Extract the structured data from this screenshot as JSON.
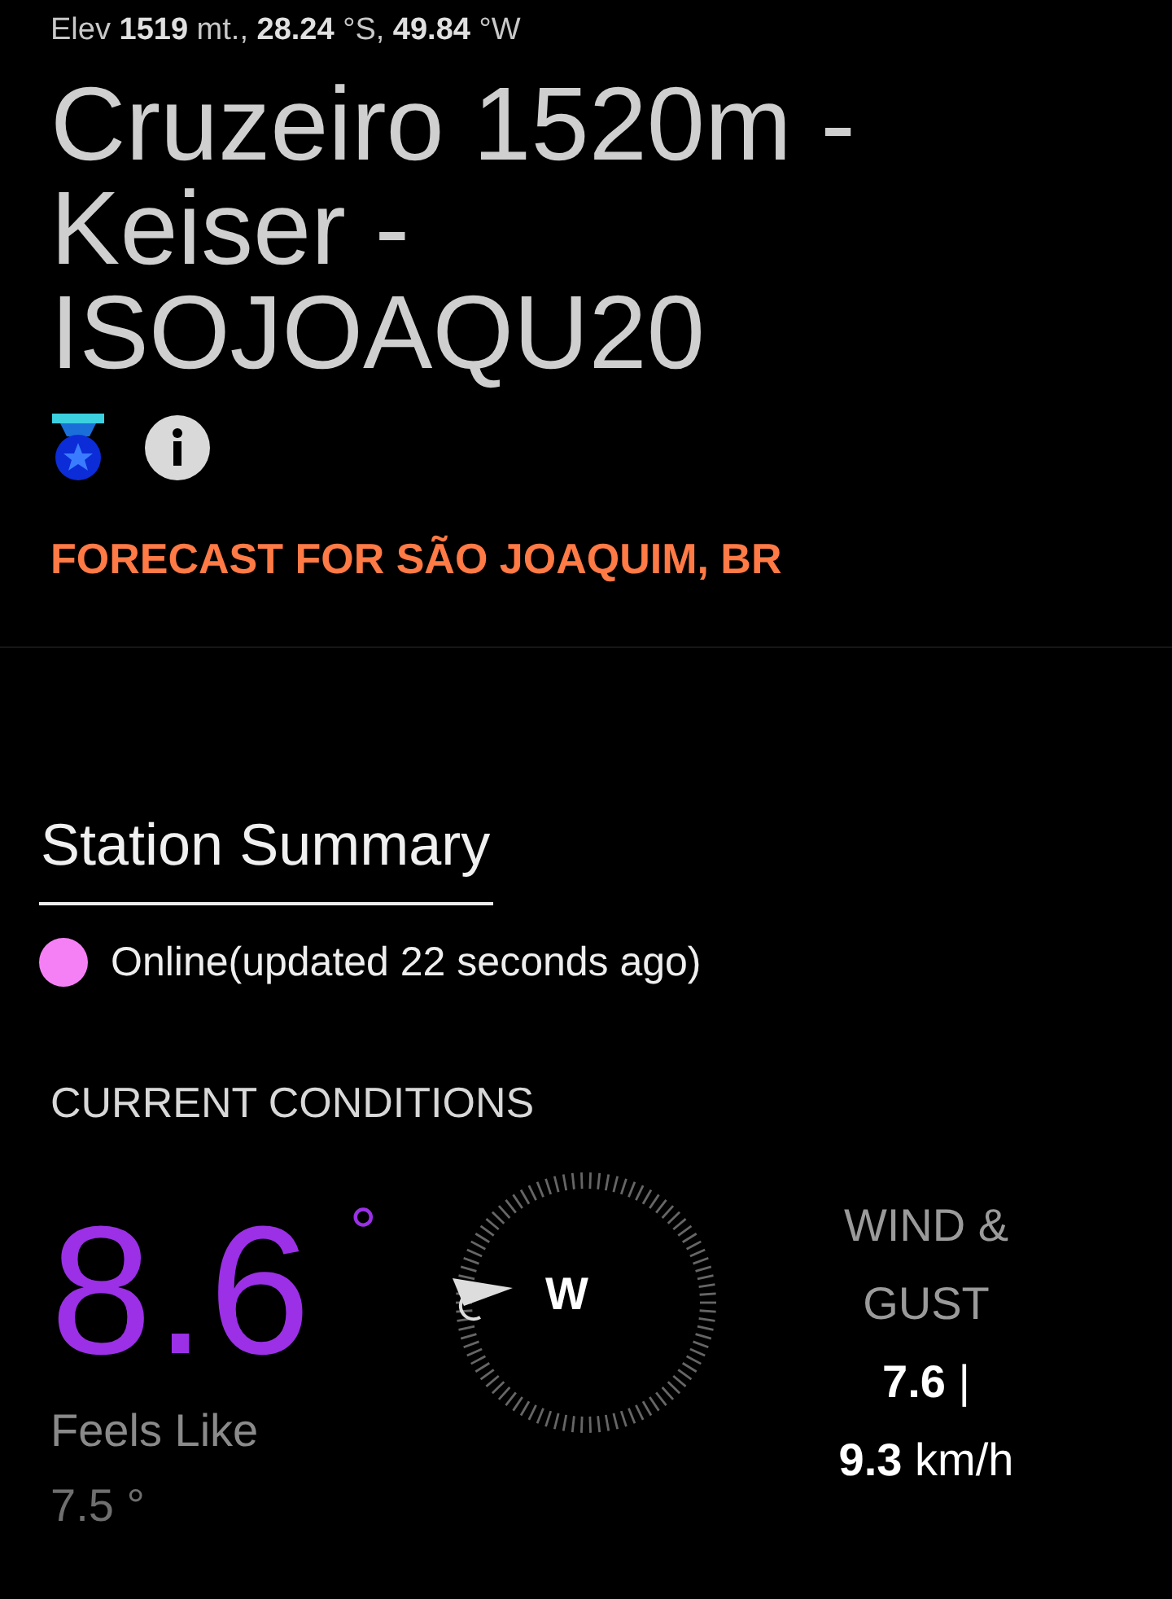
{
  "location_line": "Elev **1519** mt., **28.24** °S, **49.84** °W",
  "station": {
    "title": "Cruzeiro 1520m - Keiser - ISOJOAQU20"
  },
  "forecast_link": "FORECAST FOR SÃO JOAQUIM, BR",
  "summary": {
    "heading": "Station Summary",
    "status": {
      "text": "Online(updated 22 seconds ago)",
      "color": "#f580f5"
    }
  },
  "current": {
    "heading": "CURRENT CONDITIONS",
    "temperature": "8.6",
    "temperature_unit": "°",
    "feels_like_label": "Feels Like",
    "feels_like": "7.5 °",
    "wind": {
      "direction": "W",
      "label": "WIND & GUST",
      "speed": "**7.6**  |",
      "gust": "**9.3** km/h"
    }
  }
}
